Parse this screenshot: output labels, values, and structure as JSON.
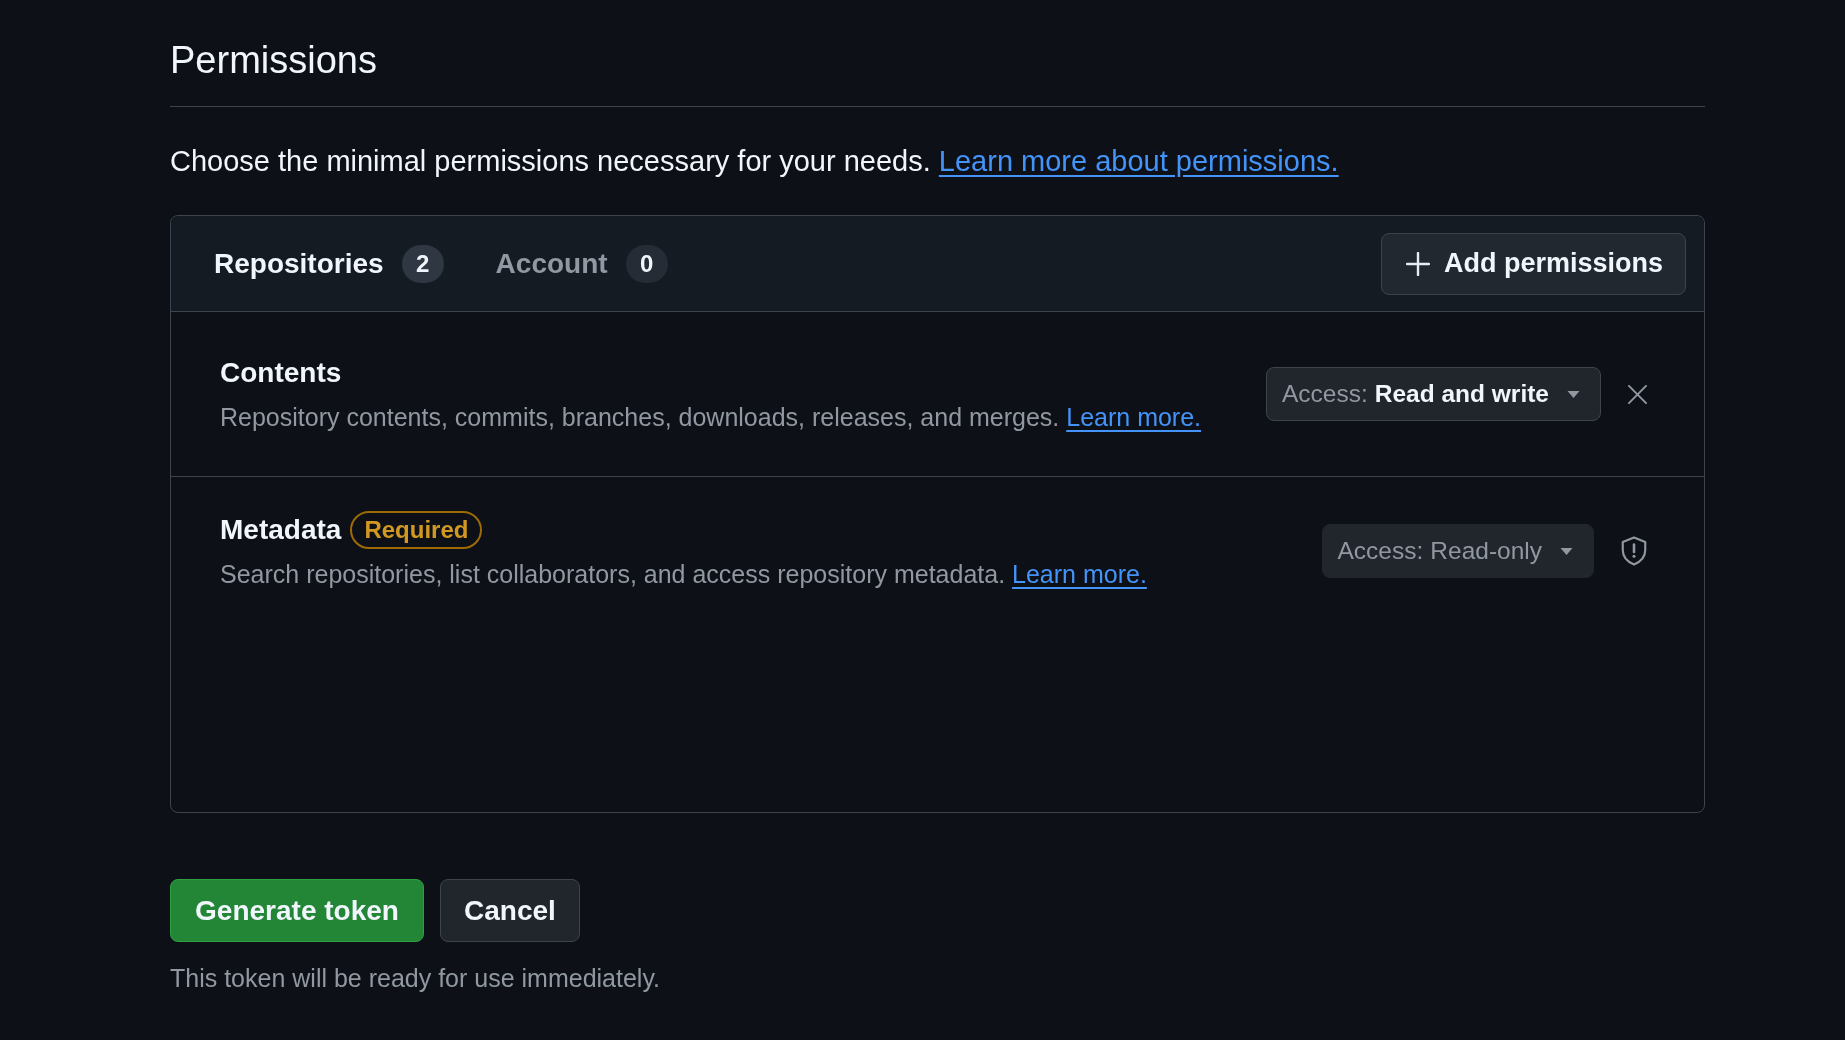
{
  "section": {
    "title": "Permissions",
    "intro": "Choose the minimal permissions necessary for your needs.",
    "intro_link": "Learn more about permissions."
  },
  "tabs": [
    {
      "label": "Repositories",
      "count": "2",
      "selected": true
    },
    {
      "label": "Account",
      "count": "0",
      "selected": false
    }
  ],
  "add_button": {
    "label": "Add permissions"
  },
  "permissions": [
    {
      "kind": "removable",
      "title": "Contents",
      "description": "Repository contents, commits, branches, downloads, releases, and merges.",
      "link": "Learn more.",
      "access_label": "Access:",
      "access_value": "Read and write",
      "disabled": false
    },
    {
      "kind": "required",
      "title": "Metadata",
      "badge": "Required",
      "description": "Search repositories, list collaborators, and access repository metadata.",
      "link": "Learn more.",
      "access_label": "Access:",
      "access_value": "Read-only",
      "disabled": true
    }
  ],
  "actions": [
    {
      "label": "Generate token",
      "kind": "primary"
    },
    {
      "label": "Cancel",
      "kind": "secondary"
    }
  ],
  "footer_note": "This token will be ready for use immediately."
}
